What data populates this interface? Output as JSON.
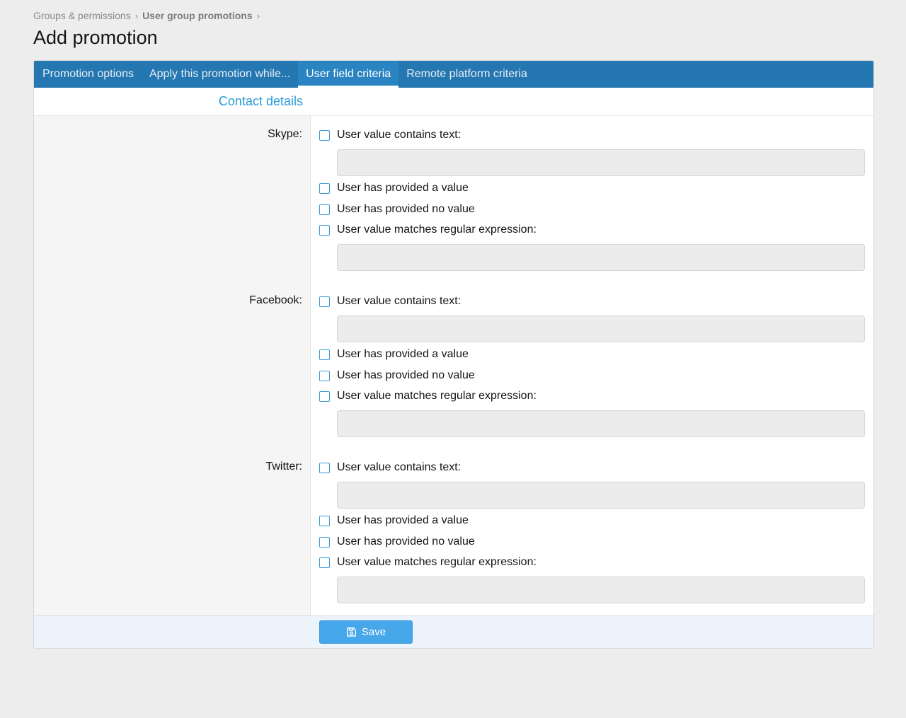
{
  "breadcrumb": {
    "items": [
      "Groups & permissions",
      "User group promotions"
    ],
    "separator": "›"
  },
  "page_title": "Add promotion",
  "tabs": [
    {
      "label": "Promotion options",
      "active": false
    },
    {
      "label": "Apply this promotion while...",
      "active": false
    },
    {
      "label": "User field criteria",
      "active": true
    },
    {
      "label": "Remote platform criteria",
      "active": false
    }
  ],
  "section_title": "Contact details",
  "options": {
    "contains": "User value contains text:",
    "provided": "User has provided a value",
    "no_value": "User has provided no value",
    "regex": "User value matches regular expression:"
  },
  "fields": [
    {
      "label": "Skype:",
      "contains_value": "",
      "regex_value": ""
    },
    {
      "label": "Facebook:",
      "contains_value": "",
      "regex_value": ""
    },
    {
      "label": "Twitter:",
      "contains_value": "",
      "regex_value": ""
    }
  ],
  "save_button": {
    "label": "Save",
    "icon": "save-icon"
  },
  "colors": {
    "tab_bar": "#2577b1",
    "accent": "#2a9ad8",
    "save_button": "#47a7eb"
  }
}
